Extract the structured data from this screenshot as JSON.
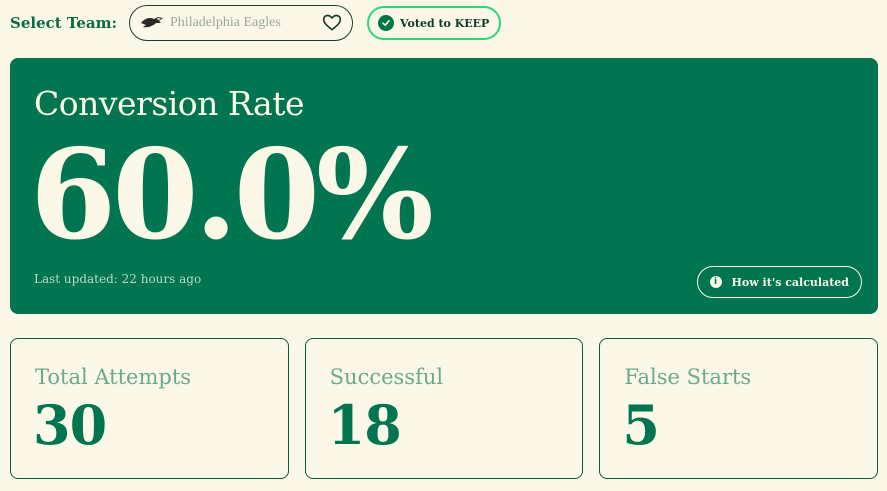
{
  "header": {
    "select_label": "Select Team:",
    "team_name": "Philadelphia Eagles",
    "vote_label": "Voted to KEEP"
  },
  "hero": {
    "title": "Conversion Rate",
    "value": "60.0%",
    "last_updated": "Last updated: 22 hours ago",
    "how_button": "How it's calculated"
  },
  "stats": [
    {
      "label": "Total Attempts",
      "value": "30"
    },
    {
      "label": "Successful",
      "value": "18"
    },
    {
      "label": "False Starts",
      "value": "5"
    }
  ],
  "icons": {
    "team_logo": "eagle-logo-icon",
    "favorite": "heart-icon",
    "vote": "check-circle-icon",
    "info": "info-icon"
  },
  "colors": {
    "background": "#fcf8e8",
    "primary_green": "#00754f",
    "accent_green": "#2ed47a"
  }
}
